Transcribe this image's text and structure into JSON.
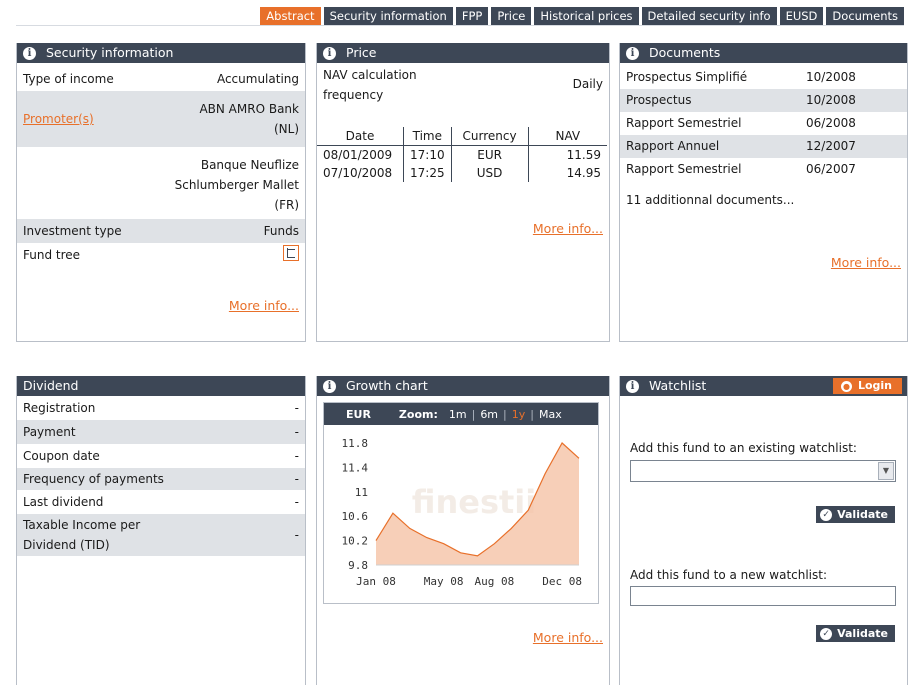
{
  "tabs": [
    "Abstract",
    "Security information",
    "FPP",
    "Price",
    "Historical prices",
    "Detailed security info",
    "EUSD",
    "Documents"
  ],
  "security": {
    "title": "Security information",
    "type_of_income_label": "Type of income",
    "type_of_income_value": "Accumulating",
    "promoters_label": "Promoter(s)",
    "promoter_1": "ABN AMRO Bank (NL)",
    "promoter_2": "Banque Neuflize Schlumberger Mallet (FR)",
    "investment_type_label": "Investment type",
    "investment_type_value": "Funds",
    "fund_tree_label": "Fund tree",
    "more": "More info..."
  },
  "price": {
    "title": "Price",
    "nav_freq_label": "NAV calculation frequency",
    "nav_freq_value": "Daily",
    "headers": [
      "Date",
      "Time",
      "Currency",
      "NAV"
    ],
    "rows": [
      [
        "08/01/2009",
        "17:10",
        "EUR",
        "11.59"
      ],
      [
        "07/10/2008",
        "17:25",
        "USD",
        "14.95"
      ]
    ],
    "more": "More info..."
  },
  "documents": {
    "title": "Documents",
    "items": [
      {
        "name": "Prospectus Simplifié",
        "date": "10/2008"
      },
      {
        "name": "Prospectus",
        "date": "10/2008"
      },
      {
        "name": "Rapport Semestriel",
        "date": "06/2008"
      },
      {
        "name": "Rapport Annuel",
        "date": "12/2007"
      },
      {
        "name": "Rapport Semestriel",
        "date": "06/2007"
      }
    ],
    "additional": "11 additionnal documents...",
    "more": "More info..."
  },
  "dividend": {
    "title": "Dividend",
    "rows": [
      {
        "label": "Registration",
        "value": "-"
      },
      {
        "label": "Payment",
        "value": "-"
      },
      {
        "label": "Coupon date",
        "value": "-"
      },
      {
        "label": "Frequency of payments",
        "value": "-"
      },
      {
        "label": "Last dividend",
        "value": "-"
      },
      {
        "label": "Taxable Income per Dividend (TID)",
        "value": "-"
      }
    ]
  },
  "growth": {
    "title": "Growth chart",
    "currency": "EUR",
    "zoom_label": "Zoom:",
    "zoom_options": [
      "1m",
      "6m",
      "1y",
      "Max"
    ],
    "zoom_selected": "1y",
    "watermark": "finestii",
    "more": "More info..."
  },
  "chart_data": {
    "type": "area",
    "x_tick_labels": [
      "Jan 08",
      "May 08",
      "Aug 08",
      "Dec 08"
    ],
    "y_tick_labels": [
      "11.8",
      "11.4",
      "11",
      "10.6",
      "10.2",
      "9.8"
    ],
    "ylim": [
      9.8,
      11.8
    ],
    "x": [
      "Jan 08",
      "Feb 08",
      "Mar 08",
      "Apr 08",
      "May 08",
      "Jun 08",
      "Jul 08",
      "Aug 08",
      "Sep 08",
      "Oct 08",
      "Nov 08",
      "Dec 08",
      "Jan 09"
    ],
    "values": [
      10.2,
      10.65,
      10.4,
      10.25,
      10.15,
      10.0,
      9.95,
      10.15,
      10.4,
      10.7,
      11.3,
      11.8,
      11.55
    ],
    "color": "#f5c3a6"
  },
  "watchlist": {
    "title": "Watchlist",
    "login": "Login",
    "existing_label": "Add this fund to an existing watchlist:",
    "new_label": "Add this fund to a new watchlist:",
    "validate": "Validate"
  }
}
